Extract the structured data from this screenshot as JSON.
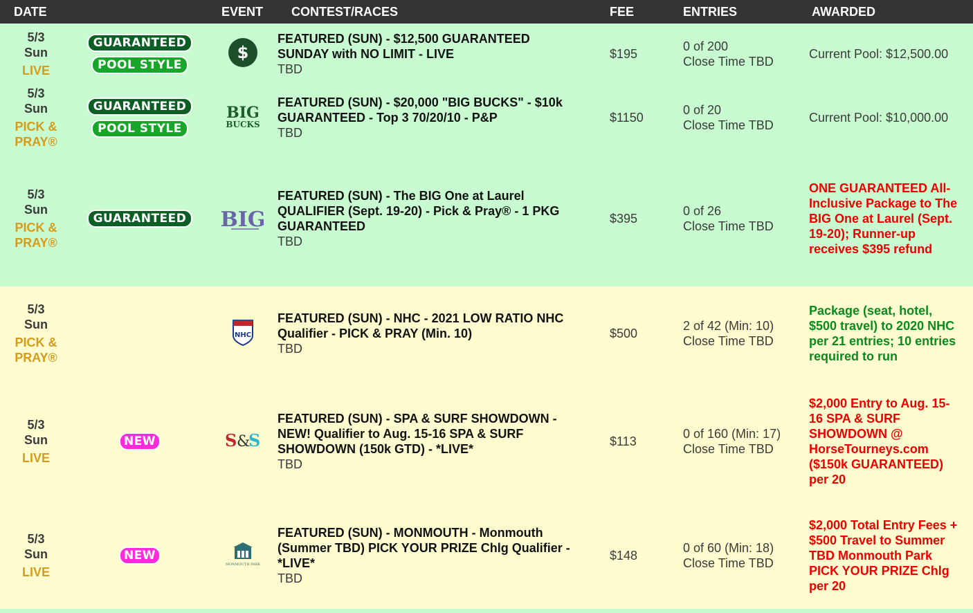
{
  "header": {
    "date": "DATE",
    "event": "EVENT",
    "contest": "CONTEST/RACES",
    "fee": "FEE",
    "entries": "ENTRIES",
    "awarded": "AWARDED"
  },
  "colors": {
    "guaranteed_badge": "#0b5e24",
    "pool_badge": "#17a52a",
    "new_badge": "#ff2ad9",
    "type_text": "#d49b1e",
    "award_red": "#ee0000",
    "award_green": "#0a8a1e"
  },
  "rows": [
    {
      "date": "5/3",
      "dow": "Sun",
      "type": "LIVE",
      "badge1": "GUARANTEED",
      "badge2": "POOL STYLE",
      "event_icon": "dollar-icon",
      "title": "FEATURED (SUN) - $12,500 GUARANTEED SUNDAY with NO LIMIT - LIVE",
      "races": "TBD",
      "fee": "$195",
      "entries": "0 of 200",
      "close": "Close Time TBD",
      "awarded": "Current Pool: $12,500.00"
    },
    {
      "date": "5/3",
      "dow": "Sun",
      "type": "PICK & PRAY®",
      "badge1": "GUARANTEED",
      "badge2": "POOL STYLE",
      "event_icon": "big-bucks-logo",
      "logo_top": "BIG",
      "logo_bottom": "BUCKS",
      "title": "FEATURED (SUN) - $20,000 \"BIG BUCKS\" - $10k GUARANTEED - Top 3 70/20/10 - P&P",
      "races": "TBD",
      "fee": "$1150",
      "entries": "0 of 20",
      "close": "Close Time TBD",
      "awarded": "Current Pool: $10,000.00"
    },
    {
      "date": "5/3",
      "dow": "Sun",
      "type": "PICK & PRAY®",
      "badge1": "GUARANTEED",
      "event_icon": "big-one-logo",
      "logo_text": "BIG",
      "title": "FEATURED (SUN) - The BIG One at Laurel QUALIFIER (Sept. 19-20) - Pick & Pray® - 1 PKG GUARANTEED",
      "races": "TBD",
      "fee": "$395",
      "entries": "0 of 26",
      "close": "Close Time TBD",
      "awarded": "ONE GUARANTEED All-Inclusive Package to The BIG One at Laurel (Sept. 19-20); Runner-up receives $395 refund"
    },
    {
      "date": "5/3",
      "dow": "Sun",
      "type": "PICK & PRAY®",
      "event_icon": "nhc-logo",
      "logo_text": "NHC",
      "title": "FEATURED (SUN) - NHC - 2021 LOW RATIO NHC Qualifier - PICK & PRAY (Min. 10)",
      "races": "TBD",
      "fee": "$500",
      "entries": "2 of 42 (Min: 10)",
      "close": "Close Time TBD",
      "awarded": "Package (seat, hotel, $500 travel) to 2020 NHC per 21 entries; 10 entries required to run"
    },
    {
      "date": "5/3",
      "dow": "Sun",
      "type": "LIVE",
      "badge1": "NEW",
      "event_icon": "spa-surf-logo",
      "logo_text": "S&S",
      "title": "FEATURED (SUN) - SPA & SURF SHOWDOWN - NEW! Qualifier to Aug. 15-16 SPA & SURF SHOWDOWN (150k GTD) - *LIVE*",
      "races": "TBD",
      "fee": "$113",
      "entries": "0 of 160 (Min: 17)",
      "close": "Close Time TBD",
      "awarded": "$2,000 Entry to Aug. 15-16 SPA & SURF SHOWDOWN @ HorseTourneys.com ($150k GUARANTEED) per 20"
    },
    {
      "date": "5/3",
      "dow": "Sun",
      "type": "LIVE",
      "badge1": "NEW",
      "event_icon": "monmouth-logo",
      "logo_text": "MONMOUTH PARK",
      "title": "FEATURED (SUN) - MONMOUTH - Monmouth (Summer TBD) PICK YOUR PRIZE Chlg Qualifier - *LIVE*",
      "races": "TBD",
      "fee": "$148",
      "entries": "0 of 60 (Min: 18)",
      "close": "Close Time TBD",
      "awarded": "$2,000 Total Entry Fees + $500 Travel to Summer TBD Monmouth Park PICK YOUR PRIZE Chlg per 20"
    }
  ]
}
